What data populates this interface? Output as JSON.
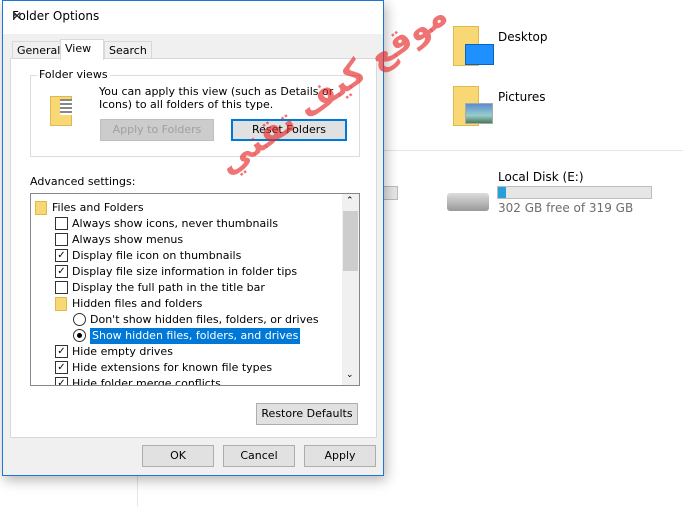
{
  "explorer": {
    "items": [
      {
        "name": "Desktop",
        "icon": "desktop-folder-icon"
      },
      {
        "name": "Pictures",
        "icon": "pictures-folder-icon"
      }
    ],
    "drive": {
      "name": "Local Disk (E:)",
      "status": "302 GB free of 319 GB",
      "used_fraction": 0.053,
      "bar_color": "#26a0da"
    }
  },
  "dialog": {
    "title": "Folder Options",
    "tabs": [
      {
        "label": "General"
      },
      {
        "label": "View",
        "selected": true
      },
      {
        "label": "Search"
      }
    ],
    "folder_views": {
      "label": "Folder views",
      "description": "You can apply this view (such as Details or Icons) to all folders of this type.",
      "apply_button": "Apply to Folders",
      "reset_button": "Reset Folders"
    },
    "advanced": {
      "label": "Advanced settings:",
      "items": [
        {
          "type": "folder",
          "label": "Files and Folders",
          "level": 0
        },
        {
          "type": "checkbox",
          "label": "Always show icons, never thumbnails",
          "checked": false
        },
        {
          "type": "checkbox",
          "label": "Always show menus",
          "checked": false
        },
        {
          "type": "checkbox",
          "label": "Display file icon on thumbnails",
          "checked": true
        },
        {
          "type": "checkbox",
          "label": "Display file size information in folder tips",
          "checked": true
        },
        {
          "type": "checkbox",
          "label": "Display the full path in the title bar",
          "checked": false
        },
        {
          "type": "folder",
          "label": "Hidden files and folders",
          "level": 1
        },
        {
          "type": "radio",
          "label": "Don't show hidden files, folders, or drives",
          "checked": false
        },
        {
          "type": "radio",
          "label": "Show hidden files, folders, and drives",
          "checked": true,
          "selected": true
        },
        {
          "type": "checkbox",
          "label": "Hide empty drives",
          "checked": true
        },
        {
          "type": "checkbox",
          "label": "Hide extensions for known file types",
          "checked": true
        },
        {
          "type": "checkbox",
          "label": "Hide folder merge conflicts",
          "checked": true
        }
      ]
    },
    "restore_button": "Restore Defaults",
    "ok": "OK",
    "cancel": "Cancel",
    "apply": "Apply"
  },
  "watermark": "موقع كيف تقني"
}
